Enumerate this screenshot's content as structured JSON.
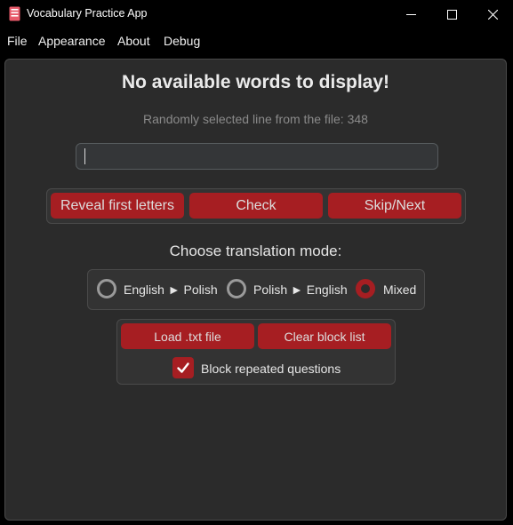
{
  "window": {
    "title": "Vocabulary Practice App",
    "icon": "book-icon",
    "controls": [
      "minimize-icon",
      "maximize-icon",
      "close-icon"
    ]
  },
  "menu": {
    "file": "File",
    "appearance": "Appearance",
    "about": "About",
    "debug": "Debug"
  },
  "main": {
    "heading": "No available words to display!",
    "subline": "Randomly selected line from the file: 348",
    "answer_value": ""
  },
  "actions": {
    "reveal": "Reveal first letters",
    "check": "Check",
    "skip": "Skip/Next"
  },
  "mode": {
    "label": "Choose translation mode:",
    "options": [
      {
        "label": "English ► Polish",
        "checked": false
      },
      {
        "label": "Polish ► English",
        "checked": false
      },
      {
        "label": "Mixed",
        "checked": true
      }
    ]
  },
  "file_controls": {
    "load": "Load .txt file",
    "clear": "Clear block list",
    "block_label": "Block repeated questions",
    "block_checked": true
  },
  "colors": {
    "accent": "#a61e22",
    "background": "#2b2b2b",
    "titlebar": "#000000"
  }
}
